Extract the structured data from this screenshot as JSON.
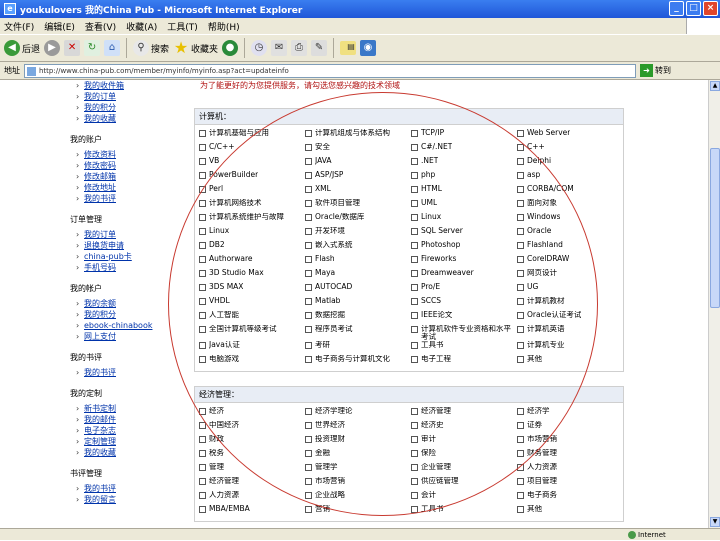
{
  "window": {
    "title": "youkulovers 我的China Pub - Microsoft Internet Explorer",
    "btn_min": "_",
    "btn_max": "□",
    "btn_close": "×"
  },
  "menu": [
    "文件(F)",
    "编辑(E)",
    "查看(V)",
    "收藏(A)",
    "工具(T)",
    "帮助(H)"
  ],
  "toolbar": {
    "back": "后退",
    "search": "搜索",
    "favorites": "收藏夹"
  },
  "address": {
    "label": "地址",
    "url": "http://www.china-pub.com/member/myinfo/myinfo.asp?act=updateinfo",
    "go": "转到"
  },
  "status": {
    "zone": "Internet"
  },
  "leftnav": {
    "top_items": [
      "我的收件箱",
      "我的订单",
      "我的积分",
      "我的收藏"
    ],
    "groups": [
      {
        "title": "我的账户",
        "items": [
          "修改资料",
          "修改密码",
          "修改邮箱",
          "修改地址",
          "我的书评"
        ]
      },
      {
        "title": "订单管理",
        "items": [
          "我的订单",
          "退换货申请",
          "china-pub卡",
          "手机号码"
        ]
      },
      {
        "title": "我的帐户",
        "items": [
          "我的余额",
          "我的积分",
          "ebook-chinabook",
          "网上支付"
        ]
      },
      {
        "title": "我的书评",
        "items": [
          "我的书评"
        ]
      },
      {
        "title": "我的定制",
        "items": [
          "新书定制",
          "我的邮件",
          "电子杂志",
          "定制管理",
          "我的收藏"
        ]
      },
      {
        "title": "书评管理",
        "items": [
          "我的书评",
          "我的留言"
        ]
      }
    ]
  },
  "main": {
    "note": "为了能更好的为您提供服务，请勾选您感兴趣的技术领域",
    "sections": [
      {
        "title": "计算机：",
        "items": [
          "计算机基础与应用",
          "计算机组成与体系结构",
          "TCP/IP",
          "Web Server",
          "C/C++",
          "安全",
          "C#/.NET",
          "C++",
          "VB",
          "JAVA",
          ".NET",
          "Delphi",
          "PowerBuilder",
          "ASP/JSP",
          "php",
          "asp",
          "Perl",
          "XML",
          "HTML",
          "CORBA/COM",
          "计算机网络技术",
          "软件项目管理",
          "UML",
          "面向对象",
          "计算机系统维护与故障",
          "Oracle/数据库",
          "Linux",
          "Windows",
          "Linux",
          "开发环境",
          "SQL Server",
          "Oracle",
          "DB2",
          "嵌入式系统",
          "Photoshop",
          "Flashland",
          "Authorware",
          "Flash",
          "Fireworks",
          "CorelDRAW",
          "3D Studio Max",
          "Maya",
          "Dreamweaver",
          "网页设计",
          "3DS MAX",
          "AUTOCAD",
          "Pro/E",
          "UG",
          "VHDL",
          "Matlab",
          "SCCS",
          "计算机教材",
          "人工智能",
          "数据挖掘",
          "IEEE论文",
          "Oracle认证考试",
          "全国计算机等级考试",
          "程序员考试",
          "计算机软件专业资格和水平考试",
          "计算机英语",
          "Java认证",
          "考研",
          "工具书",
          "计算机专业",
          "电脑游戏",
          "电子商务与计算机文化",
          "电子工程",
          "其他"
        ]
      },
      {
        "title": "经济管理：",
        "items": [
          "经济",
          "经济学理论",
          "经济管理",
          "经济学",
          "中国经济",
          "世界经济",
          "经济史",
          "证券",
          "财政",
          "投资理财",
          "审计",
          "市场营销",
          "税务",
          "金融",
          "保险",
          "财务管理",
          "管理",
          "管理学",
          "企业管理",
          "人力资源",
          "经济管理",
          "市场营销",
          "供应链管理",
          "项目管理",
          "人力资源",
          "企业战略",
          "会计",
          "电子商务",
          "MBA/EMBA",
          "营销",
          "工具书",
          "其他"
        ]
      }
    ]
  }
}
